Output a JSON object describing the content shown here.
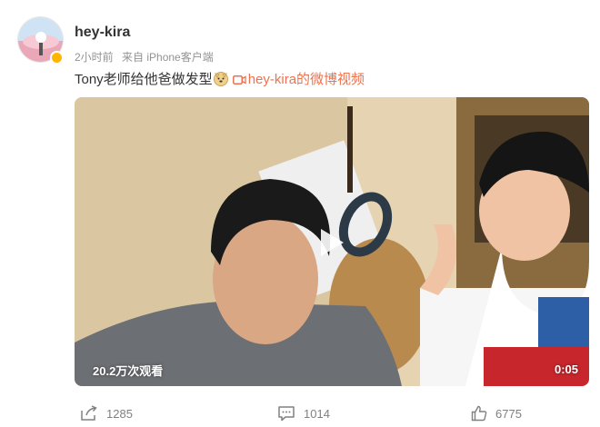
{
  "post": {
    "username": "hey-kira",
    "time": "2小时前",
    "source": "来自 iPhone客户端",
    "text": "Tony老师给他爸做发型",
    "video_link": "hey-kira的微博视频",
    "emoji": "doge-emoji",
    "avatar_icon": "avatar-image"
  },
  "video": {
    "views": "20.2万次观看",
    "duration": "0:05",
    "play_icon": "play-icon"
  },
  "actions": {
    "repost": "1285",
    "comment": "1014",
    "like": "6775"
  },
  "colors": {
    "link": "#eb7350",
    "meta": "#939393",
    "verified": "#ffb400"
  }
}
